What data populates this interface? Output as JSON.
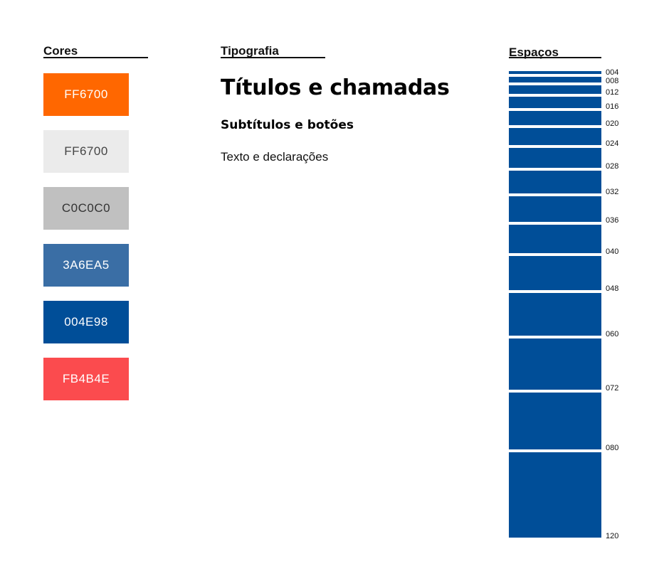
{
  "colors": {
    "title": "Cores",
    "swatches": [
      {
        "label": "FF6700",
        "color": "#FF6700",
        "text_color": "#FFFFFF"
      },
      {
        "label": "FF6700",
        "color": "#EBEBEB",
        "text_color": "#444444"
      },
      {
        "label": "C0C0C0",
        "color": "#C0C0C0",
        "text_color": "#333333"
      },
      {
        "label": "3A6EA5",
        "color": "#3A6EA5",
        "text_color": "#FFFFFF"
      },
      {
        "label": "004E98",
        "color": "#004E98",
        "text_color": "#FFFFFF"
      },
      {
        "label": "FB4B4E",
        "color": "#FB4B4E",
        "text_color": "#FFFFFF"
      }
    ]
  },
  "typography": {
    "title": "Tipografia",
    "heading": "Títulos e chamadas",
    "subheading": "Subtítulos e botões",
    "body": "Texto e declarações"
  },
  "spaces": {
    "title": "Espaços",
    "bar_color": "#004E98",
    "items": [
      {
        "label": "004",
        "value": 4
      },
      {
        "label": "008",
        "value": 8
      },
      {
        "label": "012",
        "value": 12
      },
      {
        "label": "016",
        "value": 16
      },
      {
        "label": "020",
        "value": 20
      },
      {
        "label": "024",
        "value": 24
      },
      {
        "label": "028",
        "value": 28
      },
      {
        "label": "032",
        "value": 32
      },
      {
        "label": "036",
        "value": 36
      },
      {
        "label": "040",
        "value": 40
      },
      {
        "label": "048",
        "value": 48
      },
      {
        "label": "060",
        "value": 60
      },
      {
        "label": "072",
        "value": 72
      },
      {
        "label": "080",
        "value": 80
      },
      {
        "label": "120",
        "value": 120
      }
    ]
  }
}
